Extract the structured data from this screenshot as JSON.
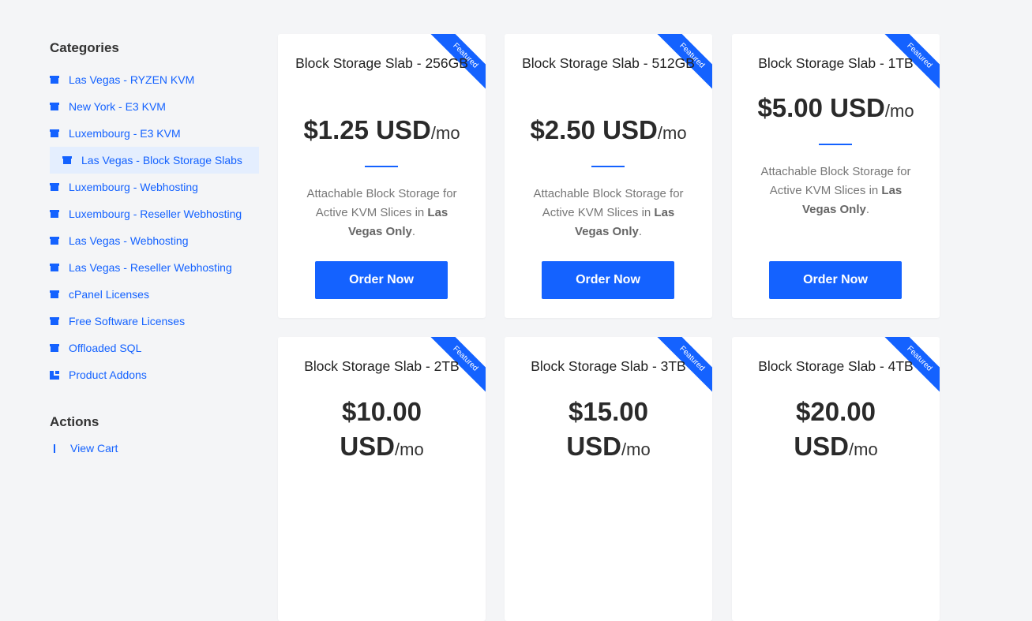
{
  "sidebar": {
    "categories_heading": "Categories",
    "actions_heading": "Actions",
    "categories": [
      {
        "label": "Las Vegas - RYZEN KVM",
        "icon": "box-icon",
        "active": false
      },
      {
        "label": "New York - E3 KVM",
        "icon": "box-icon",
        "active": false
      },
      {
        "label": "Luxembourg - E3 KVM",
        "icon": "box-icon",
        "active": false
      },
      {
        "label": "Las Vegas - Block Storage Slabs",
        "icon": "box-icon",
        "active": true
      },
      {
        "label": "Luxembourg - Webhosting",
        "icon": "box-icon",
        "active": false
      },
      {
        "label": "Luxembourg - Reseller Webhosting",
        "icon": "box-icon",
        "active": false
      },
      {
        "label": "Las Vegas - Webhosting",
        "icon": "box-icon",
        "active": false
      },
      {
        "label": "Las Vegas - Reseller Webhosting",
        "icon": "box-icon",
        "active": false
      },
      {
        "label": "cPanel Licenses",
        "icon": "box-icon",
        "active": false
      },
      {
        "label": "Free Software Licenses",
        "icon": "box-icon",
        "active": false
      },
      {
        "label": "Offloaded SQL",
        "icon": "box-icon",
        "active": false
      },
      {
        "label": "Product Addons",
        "icon": "cubes-icon",
        "active": false
      }
    ],
    "actions": [
      {
        "label": "View Cart",
        "icon": "cart-icon"
      }
    ]
  },
  "products": [
    {
      "ribbon": "Featured",
      "title": "Block Storage Slab - 256GB",
      "price": "$1.25 USD",
      "period": "/mo",
      "desc_pre": "Attachable Block Storage for Active KVM Slices in ",
      "desc_bold": "Las Vegas Only",
      "desc_post": ".",
      "button": "Order Now"
    },
    {
      "ribbon": "Featured",
      "title": "Block Storage Slab - 512GB",
      "price": "$2.50 USD",
      "period": "/mo",
      "desc_pre": "Attachable Block Storage for Active KVM Slices in ",
      "desc_bold": "Las Vegas Only",
      "desc_post": ".",
      "button": "Order Now"
    },
    {
      "ribbon": "Featured",
      "title": "Block Storage Slab - 1TB",
      "price": "$5.00 USD",
      "period": "/mo",
      "desc_pre": "Attachable Block Storage for Active KVM Slices in ",
      "desc_bold": "Las Vegas Only",
      "desc_post": ".",
      "button": "Order Now"
    },
    {
      "ribbon": "Featured",
      "title": "Block Storage Slab - 2TB",
      "price": "$10.00 USD",
      "period": "/mo",
      "desc_pre": "",
      "desc_bold": "",
      "desc_post": "",
      "button": ""
    },
    {
      "ribbon": "Featured",
      "title": "Block Storage Slab - 3TB",
      "price": "$15.00 USD",
      "period": "/mo",
      "desc_pre": "",
      "desc_bold": "",
      "desc_post": "",
      "button": ""
    },
    {
      "ribbon": "Featured",
      "title": "Block Storage Slab - 4TB",
      "price": "$20.00 USD",
      "period": "/mo",
      "desc_pre": "",
      "desc_bold": "",
      "desc_post": "",
      "button": ""
    }
  ],
  "colors": {
    "accent": "#1462ff",
    "active_bg": "#e4eefe",
    "page_bg": "#f4f5f7"
  }
}
